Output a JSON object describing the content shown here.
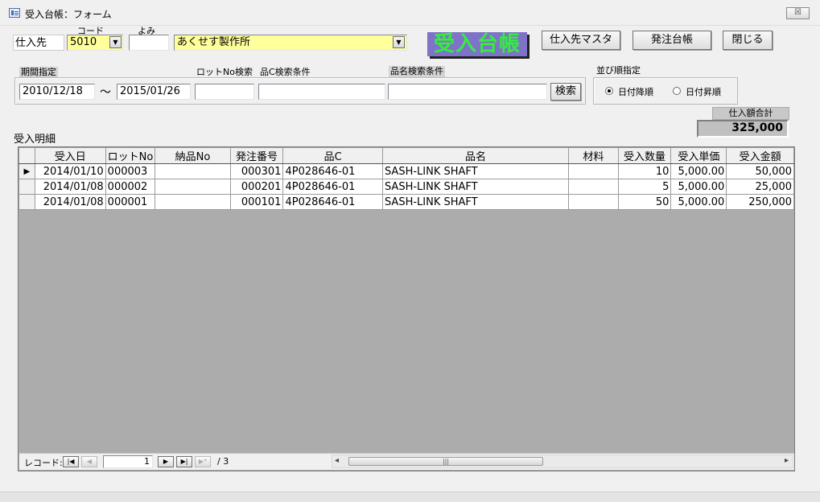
{
  "window": {
    "title": "受入台帳：フォーム",
    "close_label": "☒"
  },
  "header": {
    "supplier_label": "仕入先",
    "code_label": "コード",
    "yomi_label": "よみ",
    "code_value": "5010",
    "yomi_value": "",
    "supplier_name": "あくせす製作所",
    "banner": "受入台帳",
    "buttons": {
      "supplier_master": "仕入先マスタ",
      "order_ledger": "発注台帳",
      "close": "閉じる"
    }
  },
  "filters": {
    "period_label": "期間指定",
    "lot_label": "ロットNo検索",
    "partc_label": "品C検索条件",
    "name_label": "品名検索条件",
    "date_from": "2010/12/18",
    "tilde": "〜",
    "date_to": "2015/01/26",
    "lot_value": "",
    "partc_value": "",
    "name_value": "",
    "search_button": "検索"
  },
  "sort": {
    "label": "並び順指定",
    "option_desc": "日付降順",
    "option_asc": "日付昇順",
    "selected": "日付降順"
  },
  "total": {
    "label": "仕入額合計",
    "value": "325,000"
  },
  "details": {
    "label": "受入明細",
    "columns": [
      "受入日",
      "ロットNo",
      "納品No",
      "発注番号",
      "品C",
      "品名",
      "材料",
      "受入数量",
      "受入単価",
      "受入金額"
    ],
    "rows": [
      [
        "2014/01/10",
        "000003",
        "",
        "000301",
        "4P028646-01",
        "SASH-LINK SHAFT",
        "",
        "10",
        "5,000.00",
        "50,000"
      ],
      [
        "2014/01/08",
        "000002",
        "",
        "000201",
        "4P028646-01",
        "SASH-LINK SHAFT",
        "",
        "5",
        "5,000.00",
        "25,000"
      ],
      [
        "2014/01/08",
        "000001",
        "",
        "000101",
        "4P028646-01",
        "SASH-LINK SHAFT",
        "",
        "50",
        "5,000.00",
        "250,000"
      ]
    ],
    "current_row_marker": "▶"
  },
  "navigator": {
    "label": "レコード:",
    "current": "1",
    "total": "/ 3",
    "first": "|◀",
    "prev": "◀",
    "next": "▶",
    "last": "▶|",
    "new": "▶*"
  },
  "scrollbar": {
    "left_arrow": "◂",
    "right_arrow": "▸",
    "grip": "|||"
  }
}
